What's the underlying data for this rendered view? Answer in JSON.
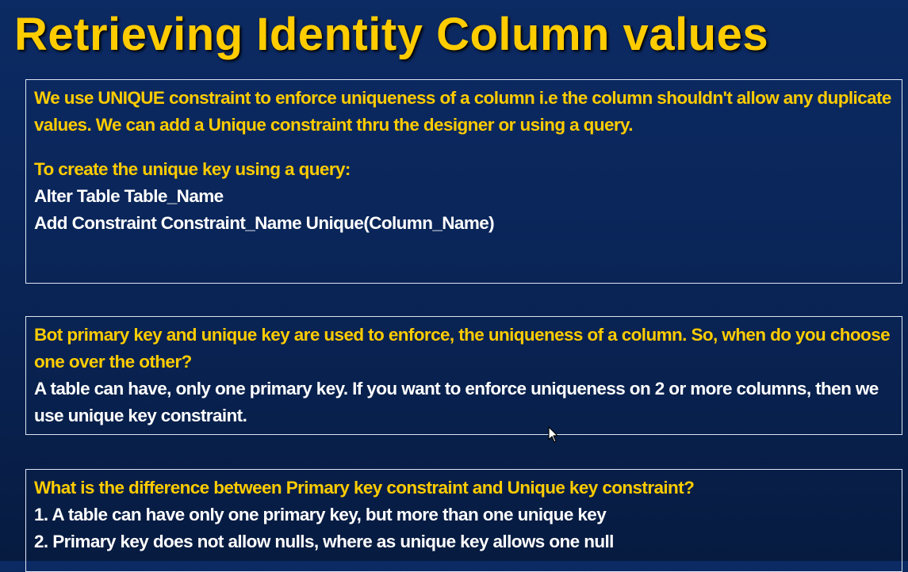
{
  "title": "Retrieving Identity Column values",
  "box1": {
    "para": "We use UNIQUE constraint to enforce uniqueness of a column i.e the column shouldn't allow any duplicate values. We can add a Unique constraint thru the designer or using a query.",
    "heading": "To create the unique key using a query:",
    "code_line1": "Alter Table Table_Name",
    "code_line2": "Add Constraint Constraint_Name Unique(Column_Name)"
  },
  "box2": {
    "question": "Bot primary key and unique key are used to enforce, the uniqueness of a column. So, when do you choose one over the other?",
    "answer": "A table can have, only one primary key. If you want to enforce uniqueness on 2 or more columns, then we use unique key constraint."
  },
  "box3": {
    "question": "What is the difference between Primary key constraint and Unique key constraint?",
    "point1": "1. A table can have only one primary key, but more than one unique key",
    "point2": "2. Primary key does not allow nulls, where as unique key allows one null"
  },
  "colors": {
    "background": "#0a2558",
    "title": "#ffcc00",
    "highlight_text": "#ffcc00",
    "body_text": "#ffffff",
    "box_border": "#dfe6f2"
  }
}
